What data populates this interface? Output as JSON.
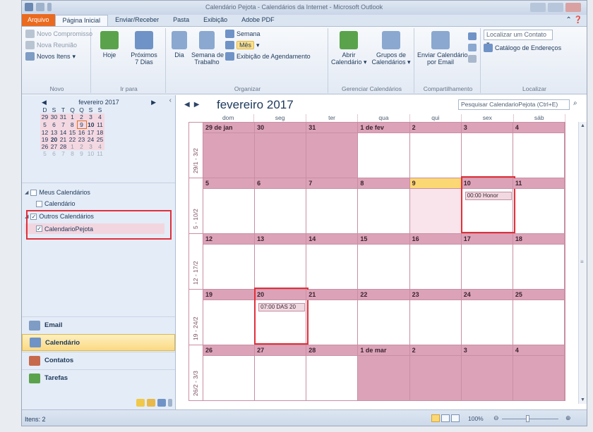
{
  "window": {
    "title": "Calendário Pejota - Calendários da Internet - Microsoft Outlook"
  },
  "tabs": [
    "Arquivo",
    "Página Inicial",
    "Enviar/Receber",
    "Pasta",
    "Exibição",
    "Adobe PDF"
  ],
  "ribbon": {
    "novo": {
      "label": "Novo",
      "items": [
        "Novo Compromisso",
        "Nova Reunião",
        "Novos Itens"
      ]
    },
    "irpara": {
      "label": "Ir para",
      "hoje": "Hoje",
      "proximos": "Próximos",
      "proximos2": "7 Dias"
    },
    "organizar": {
      "label": "Organizar",
      "dia": "Dia",
      "semana_trab": "Semana de",
      "semana_trab2": "Trabalho",
      "semana": "Semana",
      "mes": "Mês",
      "exibicao": "Exibição de Agendamento"
    },
    "gerenciar": {
      "label": "Gerenciar Calendários",
      "abrir": "Abrir",
      "abrir2": "Calendário",
      "grupos": "Grupos de",
      "grupos2": "Calendários"
    },
    "compartilhamento": {
      "label": "Compartilhamento",
      "enviar": "Enviar Calendário",
      "enviar2": "por Email"
    },
    "localizar": {
      "label": "Localizar",
      "contato": "Localizar um Contato",
      "catalogo": "Catálogo de Endereços"
    }
  },
  "minical": {
    "title": "fevereiro 2017",
    "dow": [
      "D",
      "S",
      "T",
      "Q",
      "Q",
      "S",
      "S"
    ],
    "weeks": [
      [
        "29",
        "30",
        "31",
        "1",
        "2",
        "3",
        "4"
      ],
      [
        "5",
        "6",
        "7",
        "8",
        "9",
        "10",
        "11"
      ],
      [
        "12",
        "13",
        "14",
        "15",
        "16",
        "17",
        "18"
      ],
      [
        "19",
        "20",
        "21",
        "22",
        "23",
        "24",
        "25"
      ],
      [
        "26",
        "27",
        "28",
        "1",
        "2",
        "3",
        "4"
      ],
      [
        "5",
        "6",
        "7",
        "8",
        "9",
        "10",
        "11"
      ]
    ]
  },
  "calendars": {
    "meus": "Meus Calendários",
    "calendario": "Calendário",
    "outros": "Outros Calendários",
    "pejota": "CalendarioPejota"
  },
  "navbuttons": [
    "Email",
    "Calendário",
    "Contatos",
    "Tarefas"
  ],
  "calendar": {
    "month_title": "fevereiro 2017",
    "search_placeholder": "Pesquisar CalendarioPejota (Ctrl+E)",
    "dow": [
      "dom",
      "seg",
      "ter",
      "qua",
      "qui",
      "sex",
      "sáb"
    ],
    "weeks": [
      {
        "label": "29/1 - 3/2",
        "days": [
          "29 de jan",
          "30",
          "31",
          "1 de fev",
          "2",
          "3",
          "4"
        ]
      },
      {
        "label": "5 - 10/2",
        "days": [
          "5",
          "6",
          "7",
          "8",
          "9",
          "10",
          "11"
        ]
      },
      {
        "label": "12 - 17/2",
        "days": [
          "12",
          "13",
          "14",
          "15",
          "16",
          "17",
          "18"
        ]
      },
      {
        "label": "19 - 24/2",
        "days": [
          "19",
          "20",
          "21",
          "22",
          "23",
          "24",
          "25"
        ]
      },
      {
        "label": "26/2 - 3/3",
        "days": [
          "26",
          "27",
          "28",
          "1 de mar",
          "2",
          "3",
          "4"
        ]
      }
    ],
    "events": [
      {
        "week": 1,
        "day": 5,
        "text": "00:00 Honor"
      },
      {
        "week": 3,
        "day": 1,
        "text": "07:00 DAS 20"
      }
    ]
  },
  "status": {
    "items": "Itens: 2",
    "zoom": "100%"
  },
  "colors": {
    "accent": "#ea6a1f",
    "month_bg": "#dca3b8",
    "today": "#fbd873",
    "highlight": "#e0303a"
  }
}
